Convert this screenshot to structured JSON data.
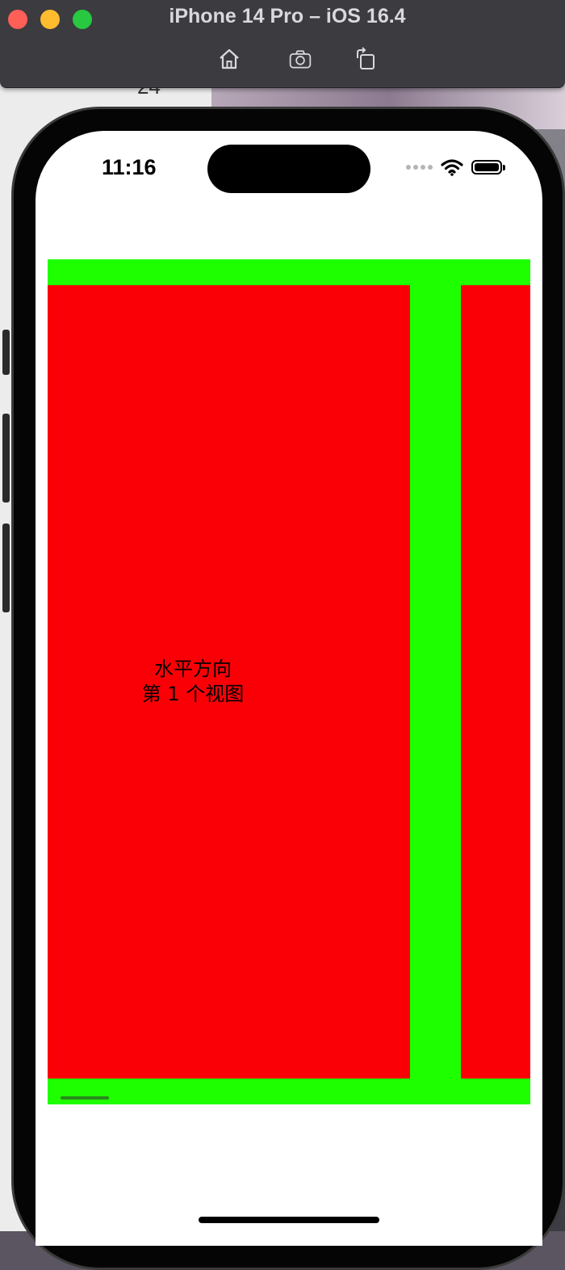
{
  "window": {
    "title": "iPhone 14 Pro – iOS 16.4",
    "toolbar": {
      "home_icon": "home-icon",
      "screenshot_icon": "camera-icon",
      "rotate_icon": "rotate-icon"
    }
  },
  "background": {
    "partial_glyph": "24"
  },
  "status_bar": {
    "time": "11:16"
  },
  "content": {
    "container_color": "#1eff00",
    "view_color": "#fa0006",
    "view_1": {
      "line1": "水平方向",
      "line2": "第 1 个视图"
    }
  }
}
